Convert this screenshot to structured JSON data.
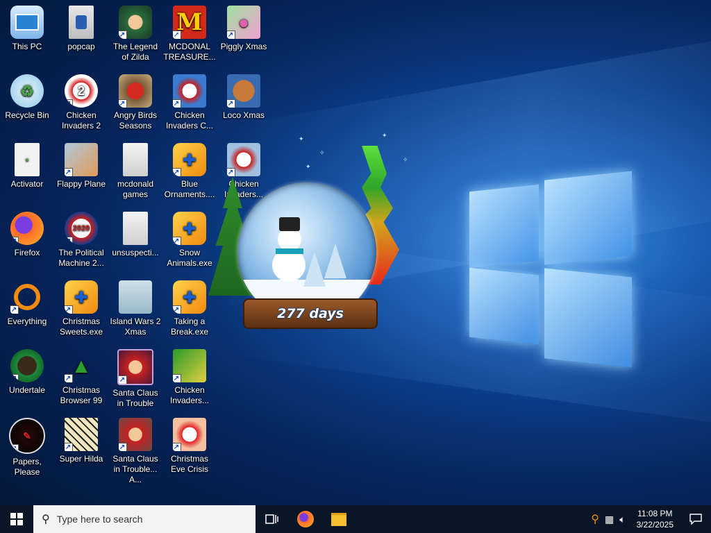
{
  "desktop": {
    "icons": [
      {
        "label": "This PC"
      },
      {
        "label": "Recycle Bin"
      },
      {
        "label": "Activator"
      },
      {
        "label": "Firefox"
      },
      {
        "label": "Everything"
      },
      {
        "label": "Undertale"
      },
      {
        "label": "Papers, Please"
      },
      {
        "label": "popcap"
      },
      {
        "label": "Chicken Invaders 2"
      },
      {
        "label": "Flappy Plane"
      },
      {
        "label": "The Political Machine 2..."
      },
      {
        "label": "Christmas Sweets.exe"
      },
      {
        "label": "Christmas Browser 99"
      },
      {
        "label": "Super Hilda"
      },
      {
        "label": "The Legend of Zilda"
      },
      {
        "label": "Angry Birds Seasons"
      },
      {
        "label": "mcdonald games"
      },
      {
        "label": "unsuspecti..."
      },
      {
        "label": "Island Wars 2 Xmas"
      },
      {
        "label": "Santa Claus in Trouble"
      },
      {
        "label": "Santa Claus in Trouble... A..."
      },
      {
        "label": "MCDONAL TREASURE..."
      },
      {
        "label": "Chicken Invaders C..."
      },
      {
        "label": "Blue Ornaments...."
      },
      {
        "label": "Snow Animals.exe"
      },
      {
        "label": "Taking a Break.exe"
      },
      {
        "label": "Chicken Invaders..."
      },
      {
        "label": "Christmas Eve Crisis"
      },
      {
        "label": "Piggly Xmas"
      },
      {
        "label": "Loco Xmas"
      },
      {
        "label": "Chicken Invaders..."
      }
    ]
  },
  "gadget": {
    "countdown": "277 days"
  },
  "taskbar": {
    "search_placeholder": "Type here to search",
    "time": "11:08 PM",
    "date": "3/22/2025"
  },
  "colors": {
    "taskbar": "#0a1526",
    "desktop_dark": "#031634",
    "desktop_light": "#3f8fe0"
  }
}
